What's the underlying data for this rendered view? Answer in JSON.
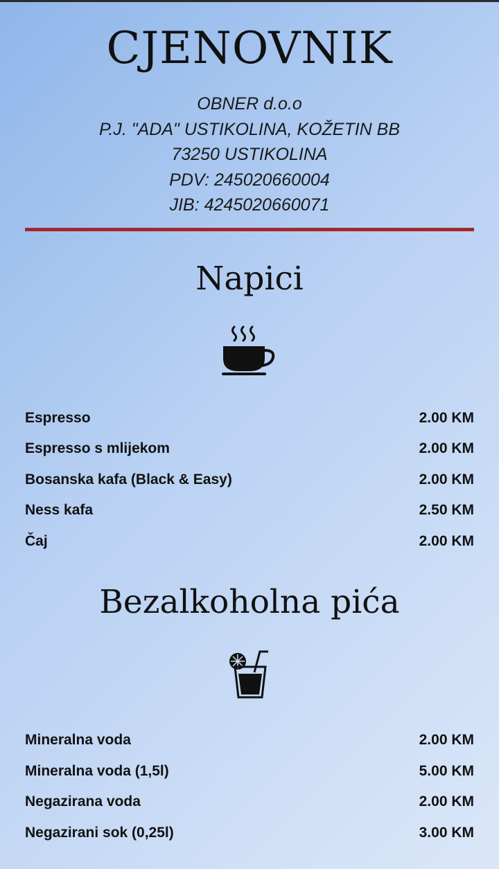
{
  "header": {
    "title": "CJENOVNIK",
    "company_lines": [
      "OBNER d.o.o",
      "P.J. \"ADA\" USTIKOLINA, KOŽETIN BB",
      "73250 USTIKOLINA",
      "PDV: 245020660004",
      "JIB: 4245020660071"
    ]
  },
  "colors": {
    "divider": "#a2282c",
    "background_start": "#8fb6ea",
    "background_end": "#dbe7f8"
  },
  "sections": [
    {
      "title": "Napici",
      "icon": "coffee-cup-icon",
      "items": [
        {
          "name": "Espresso",
          "price": "2.00 KM"
        },
        {
          "name": "Espresso s mlijekom",
          "price": "2.00 KM"
        },
        {
          "name": "Bosanska kafa (Black & Easy)",
          "price": "2.00 KM"
        },
        {
          "name": "Ness kafa",
          "price": "2.50 KM"
        },
        {
          "name": "Čaj",
          "price": "2.00 KM"
        }
      ]
    },
    {
      "title": "Bezalkoholna pića",
      "icon": "soft-drink-icon",
      "items": [
        {
          "name": "Mineralna voda",
          "price": "2.00 KM"
        },
        {
          "name": "Mineralna voda (1,5l)",
          "price": "5.00 KM"
        },
        {
          "name": "Negazirana voda",
          "price": "2.00 KM"
        },
        {
          "name": "Negazirani sok (0,25l)",
          "price": "3.00 KM"
        }
      ]
    }
  ]
}
